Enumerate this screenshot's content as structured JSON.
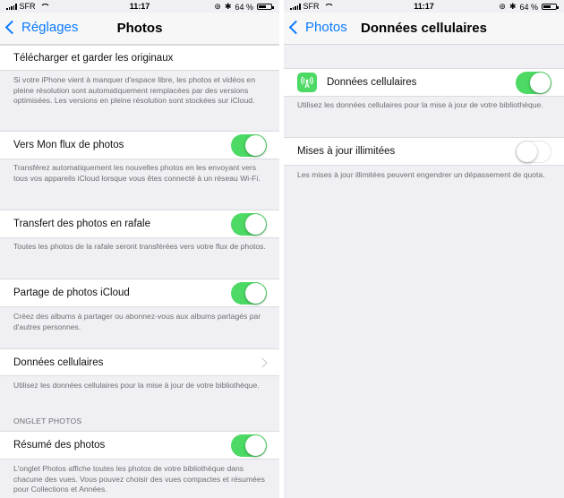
{
  "left": {
    "status": {
      "carrier": "SFR",
      "time": "11:17",
      "battery": "64 %",
      "battery_level": 0.64
    },
    "nav": {
      "back": "Réglages",
      "title": "Photos"
    },
    "download_cell": {
      "label": "Télécharger et garder les originaux"
    },
    "download_footer": "Si votre iPhone vient à manquer d'espace libre, les photos et vidéos en pleine résolution sont automatiquement remplacées par des versions optimisées. Les versions en pleine résolution sont stockées sur iCloud.",
    "photostream": {
      "label": "Vers Mon flux de photos",
      "on": true,
      "footer": "Transférez automatiquement les nouvelles photos en les envoyant vers tous vos appareils iCloud lorsque vous êtes connecté à un réseau Wi-Fi."
    },
    "burst": {
      "label": "Transfert des photos en rafale",
      "on": true,
      "footer": "Toutes les photos de la rafale seront transférées vers votre flux de photos."
    },
    "sharing": {
      "label": "Partage de photos iCloud",
      "on": true,
      "footer": "Créez des albums à partager ou abonnez-vous aux albums partagés par d'autres personnes."
    },
    "cellular": {
      "label": "Données cellulaires",
      "footer": "Utilisez les données cellulaires pour la mise à jour de votre bibliothèque."
    },
    "photos_tab_header": "ONGLET PHOTOS",
    "summary": {
      "label": "Résumé des photos",
      "on": true,
      "footer": "L'onglet Photos affiche toutes les photos de votre bibliothèque dans chacune des vues. Vous pouvez choisir des vues compactes et résumées pour Collections et Années."
    }
  },
  "right": {
    "status": {
      "carrier": "SFR",
      "time": "11:17",
      "battery": "64 %",
      "battery_level": 0.64
    },
    "nav": {
      "back": "Photos",
      "title": "Données cellulaires"
    },
    "cellular_data": {
      "label": "Données cellulaires",
      "icon": "cellular-antenna-icon",
      "on": true,
      "footer": "Utilisez les données cellulaires pour la mise à jour de votre bibliothèque."
    },
    "unlimited": {
      "label": "Mises à jour illimitées",
      "on": false,
      "footer": "Les mises à jour illimitées peuvent engendrer un dépassement de quota."
    }
  },
  "colors": {
    "accent": "#0a7aff",
    "toggle_on": "#4cd964",
    "background": "#efeff4",
    "footer_text": "#6d6d72"
  }
}
